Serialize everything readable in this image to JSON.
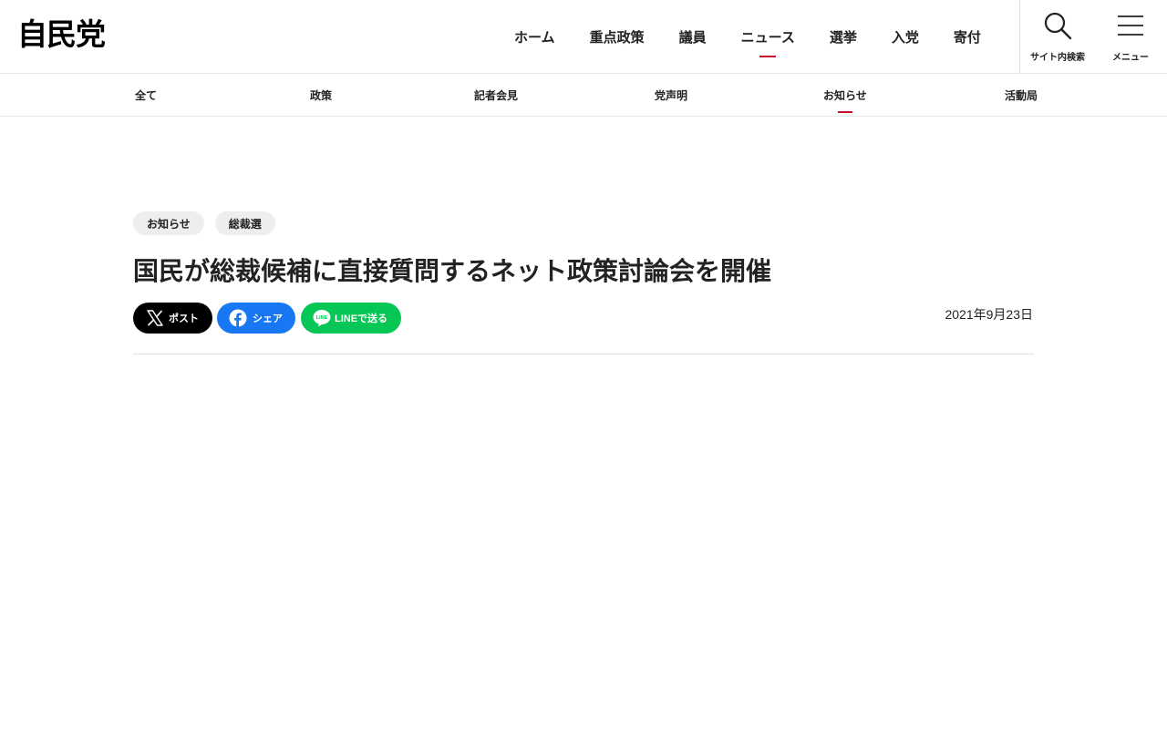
{
  "header": {
    "logo_text": "自民党",
    "nav": [
      {
        "label": "ホーム",
        "active": false
      },
      {
        "label": "重点政策",
        "active": false
      },
      {
        "label": "議員",
        "active": false
      },
      {
        "label": "ニュース",
        "active": true
      },
      {
        "label": "選挙",
        "active": false
      },
      {
        "label": "入党",
        "active": false
      },
      {
        "label": "寄付",
        "active": false
      }
    ],
    "search": {
      "label": "サイト内検索",
      "icon": "search-icon"
    },
    "menu": {
      "label": "メニュー",
      "icon": "hamburger-icon"
    }
  },
  "subnav": {
    "items": [
      {
        "label": "全て",
        "active": false
      },
      {
        "label": "政策",
        "active": false
      },
      {
        "label": "記者会見",
        "active": false
      },
      {
        "label": "党声明",
        "active": false
      },
      {
        "label": "お知らせ",
        "active": true
      },
      {
        "label": "活動局",
        "active": false
      }
    ]
  },
  "article": {
    "tags": [
      "お知らせ",
      "総裁選"
    ],
    "title": "国民が総裁候補に直接質問するネット政策討論会を開催",
    "share": {
      "x_label": "ポスト",
      "facebook_label": "シェア",
      "line_label": "LINEで送る",
      "line_icon_text": "LINE"
    },
    "date": "2021年9月23日"
  },
  "colors": {
    "accent": "#c8102e",
    "x_bg": "#000000",
    "facebook_bg": "#1877f2",
    "line_bg": "#06c755",
    "tag_bg": "#eeeeee",
    "text": "#222222"
  }
}
